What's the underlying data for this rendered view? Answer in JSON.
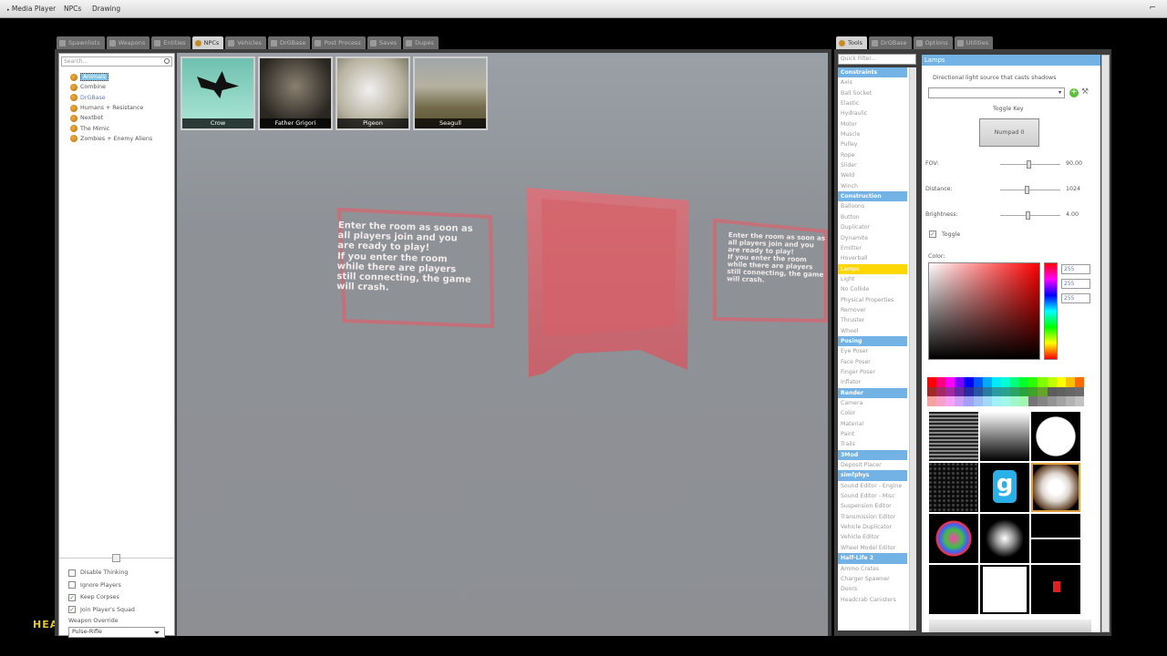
{
  "topbar": {
    "menus": [
      "Media Player",
      "NPCs",
      "Drawing"
    ],
    "hud_text": "HEA"
  },
  "spawn_tabs": [
    {
      "label": "Spawnlists",
      "active": false
    },
    {
      "label": "Weapons",
      "active": false
    },
    {
      "label": "Entities",
      "active": false
    },
    {
      "label": "NPCs",
      "active": true
    },
    {
      "label": "Vehicles",
      "active": false
    },
    {
      "label": "DrGBase",
      "active": false
    },
    {
      "label": "Post Process",
      "active": false
    },
    {
      "label": "Saves",
      "active": false
    },
    {
      "label": "Dupes",
      "active": false
    }
  ],
  "npc_search": {
    "placeholder": "Search..."
  },
  "npc_categories": [
    {
      "label": "Animals",
      "selected": true
    },
    {
      "label": "Combine",
      "selected": false
    },
    {
      "label": "DrGBase",
      "selected": false
    },
    {
      "label": "Humans + Resistance",
      "selected": false
    },
    {
      "label": "Nextbot",
      "selected": false
    },
    {
      "label": "The Mimic",
      "selected": false
    },
    {
      "label": "Zombies + Enemy Aliens",
      "selected": false
    }
  ],
  "npc_options": [
    {
      "label": "Disable Thinking",
      "checked": false
    },
    {
      "label": "Ignore Players",
      "checked": false
    },
    {
      "label": "Keep Corpses",
      "checked": true
    },
    {
      "label": "Join Player's Squad",
      "checked": true
    }
  ],
  "weapon_override": {
    "label": "Weapon Override",
    "value": "Pulse-Rifle"
  },
  "npc_icons": [
    "Crow",
    "Father Grigori",
    "Pigeon",
    "Seagull"
  ],
  "room_sign": {
    "left": [
      "Enter the room as soon as",
      "all players join and you",
      "are ready to play!",
      "If you enter the room",
      "while there are players",
      "still connecting, the game",
      "will crash."
    ],
    "right": [
      "Enter the room as soon as",
      "all players join and you",
      "are ready to play!",
      "If you enter the room",
      "while there are players",
      "still connecting, the game",
      "will crash."
    ]
  },
  "tool_tabs": [
    {
      "label": "Tools",
      "active": true
    },
    {
      "label": "DrGBase",
      "active": false
    },
    {
      "label": "Options",
      "active": false
    },
    {
      "label": "Utilities",
      "active": false
    }
  ],
  "quick_filter": {
    "placeholder": "Quick Filter..."
  },
  "tool_list": [
    {
      "label": "Constraints",
      "type": "cat"
    },
    {
      "label": "Axis"
    },
    {
      "label": "Ball Socket"
    },
    {
      "label": "Elastic"
    },
    {
      "label": "Hydraulic"
    },
    {
      "label": "Motor"
    },
    {
      "label": "Muscle"
    },
    {
      "label": "Pulley"
    },
    {
      "label": "Rope"
    },
    {
      "label": "Slider"
    },
    {
      "label": "Weld"
    },
    {
      "label": "Winch"
    },
    {
      "label": "Construction",
      "type": "cat"
    },
    {
      "label": "Balloons"
    },
    {
      "label": "Button"
    },
    {
      "label": "Duplicator"
    },
    {
      "label": "Dynamite"
    },
    {
      "label": "Emitter"
    },
    {
      "label": "Hoverball"
    },
    {
      "label": "Lamps",
      "type": "sel"
    },
    {
      "label": "Light"
    },
    {
      "label": "No Collide"
    },
    {
      "label": "Physical Properties"
    },
    {
      "label": "Remover"
    },
    {
      "label": "Thruster"
    },
    {
      "label": "Wheel"
    },
    {
      "label": "Posing",
      "type": "cat"
    },
    {
      "label": "Eye Poser"
    },
    {
      "label": "Face Poser"
    },
    {
      "label": "Finger Poser"
    },
    {
      "label": "Inflator"
    },
    {
      "label": "Render",
      "type": "cat"
    },
    {
      "label": "Camera"
    },
    {
      "label": "Color"
    },
    {
      "label": "Material"
    },
    {
      "label": "Paint"
    },
    {
      "label": "Trails"
    },
    {
      "label": "3Mod",
      "type": "cat"
    },
    {
      "label": "Deposit Placer"
    },
    {
      "label": "simfphys",
      "type": "cat"
    },
    {
      "label": "Sound Editor - Engine"
    },
    {
      "label": "Sound Editor - Misc"
    },
    {
      "label": "Suspension Editor"
    },
    {
      "label": "Transmission Editor"
    },
    {
      "label": "Vehicle Duplicator"
    },
    {
      "label": "Vehicle Editor"
    },
    {
      "label": "Wheel Model Editor"
    },
    {
      "label": "Half-Life 2",
      "type": "cat"
    },
    {
      "label": "Ammo Crates"
    },
    {
      "label": "Charger Spawner"
    },
    {
      "label": "Doors"
    },
    {
      "label": "Headcrab Canisters"
    }
  ],
  "lamp_panel": {
    "title": "Lamps",
    "description": "Directional light source that casts shadows",
    "toggle_key_label": "Toggle Key",
    "key_button": "Numpad 0",
    "sliders": [
      {
        "label": "FOV:",
        "value": "90.00",
        "frac": 0.49
      },
      {
        "label": "Distance:",
        "value": "1024",
        "frac": 0.45
      },
      {
        "label": "Brightness:",
        "value": "4.00",
        "frac": 0.47
      }
    ],
    "toggle": {
      "label": "Toggle",
      "checked": true
    },
    "color_label": "Color:",
    "rgb": [
      "255",
      "255",
      "255"
    ]
  },
  "colors": {
    "accent": "#72b2e4",
    "selected": "#ffd700",
    "sign": "#d9636b"
  }
}
